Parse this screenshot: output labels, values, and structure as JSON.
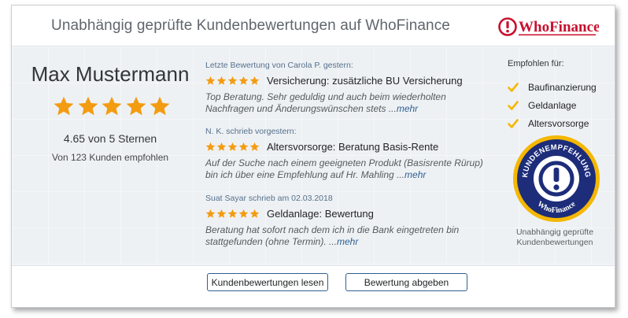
{
  "header": {
    "title": "Unabhängig geprüfte Kundenbewertungen auf WhoFinance",
    "logo_text": "WhoFinance"
  },
  "profile": {
    "name": "Max Mustermann",
    "stars": 5,
    "rating_text": "4.65 von 5 Sternen",
    "recommend_text": "Von 123 Kunden empfohlen"
  },
  "reviews": [
    {
      "meta": "Letzte Bewertung von Carola P. gestern:",
      "stars": 5,
      "title": "Versicherung: zusätzliche BU Versicherung",
      "text": "Top Beratung. Sehr geduldig und auch beim wiederholten Nachfragen und Änderungswünschen stets ...",
      "more": "mehr"
    },
    {
      "meta": "N. K. schrieb vorgestern:",
      "stars": 5,
      "title": "Altersvorsorge: Beratung Basis-Rente",
      "text": "Auf der Suche nach einem geeigneten Produkt (Basisrente Rürup) bin ich über eine Empfehlung auf Hr. Mahling ...",
      "more": "mehr"
    },
    {
      "meta": "Suat Sayar schrieb am 02.03.2018",
      "stars": 5,
      "title": "Geldanlage: Bewertung",
      "text": "Beratung hat sofort nach dem ich in die Bank eingetreten bin stattgefunden (ohne Termin). ...",
      "more": "mehr"
    }
  ],
  "recommendations": {
    "title": "Empfohlen für:",
    "items": [
      "Baufinanzierung",
      "Geldanlage",
      "Altersvorsorge"
    ]
  },
  "seal": {
    "top_text": "KUNDENEMPFEHLUNG",
    "bottom_text": "WhoFinance",
    "caption_line1": "Unabhängig geprüfte",
    "caption_line2": "Kundenbewertungen"
  },
  "buttons": {
    "read": "Kundenbewertungen lesen",
    "write": "Bewertung abgeben"
  },
  "colors": {
    "star": "#f39c12",
    "check": "#f5b700",
    "brand_red": "#c8102e",
    "link": "#2f5f92"
  }
}
